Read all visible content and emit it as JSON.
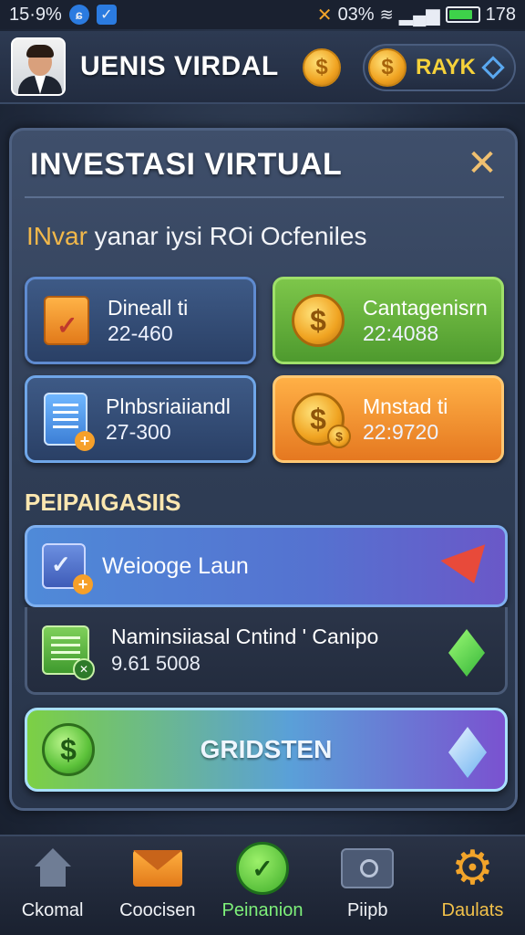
{
  "status": {
    "time": "15·9%",
    "battery_text": "03%",
    "right_num": "178",
    "battery_level": 0.85
  },
  "header": {
    "username": "UENIS VIRDAL",
    "rank_label": "RAYK"
  },
  "panel": {
    "title": "INVESTASI VIRTUAL",
    "subtitle_highlight": "INvar",
    "subtitle_rest": " yanar iysi ROi Ocfeniles",
    "cards": [
      {
        "label": "Dineall ti",
        "value": "22-460",
        "icon": "clipboard-check-icon"
      },
      {
        "label": "Cantagenisrn",
        "value": "22:4088",
        "icon": "gold-coin-icon"
      },
      {
        "label": "Plnbsriaiiandl",
        "value": "27-300",
        "icon": "document-plus-icon"
      },
      {
        "label": "Mnstad ti",
        "value": "22:9720",
        "icon": "coin-stack-icon"
      }
    ],
    "section_label": "PEIPAIGASIIS",
    "mission_label": "Weiooge Laun",
    "reward_label": "Naminsiiasal Cntind ' Canipo",
    "reward_value": "9.61 5008",
    "primary_button": "GRIDSTEN"
  },
  "nav": [
    {
      "label": "Ckomal",
      "icon": "home-icon"
    },
    {
      "label": "Coocisen",
      "icon": "mail-icon"
    },
    {
      "label": "Peinanion",
      "icon": "chart-check-icon"
    },
    {
      "label": "Piipb",
      "icon": "camera-icon"
    },
    {
      "label": "Daulats",
      "icon": "gear-icon"
    }
  ]
}
